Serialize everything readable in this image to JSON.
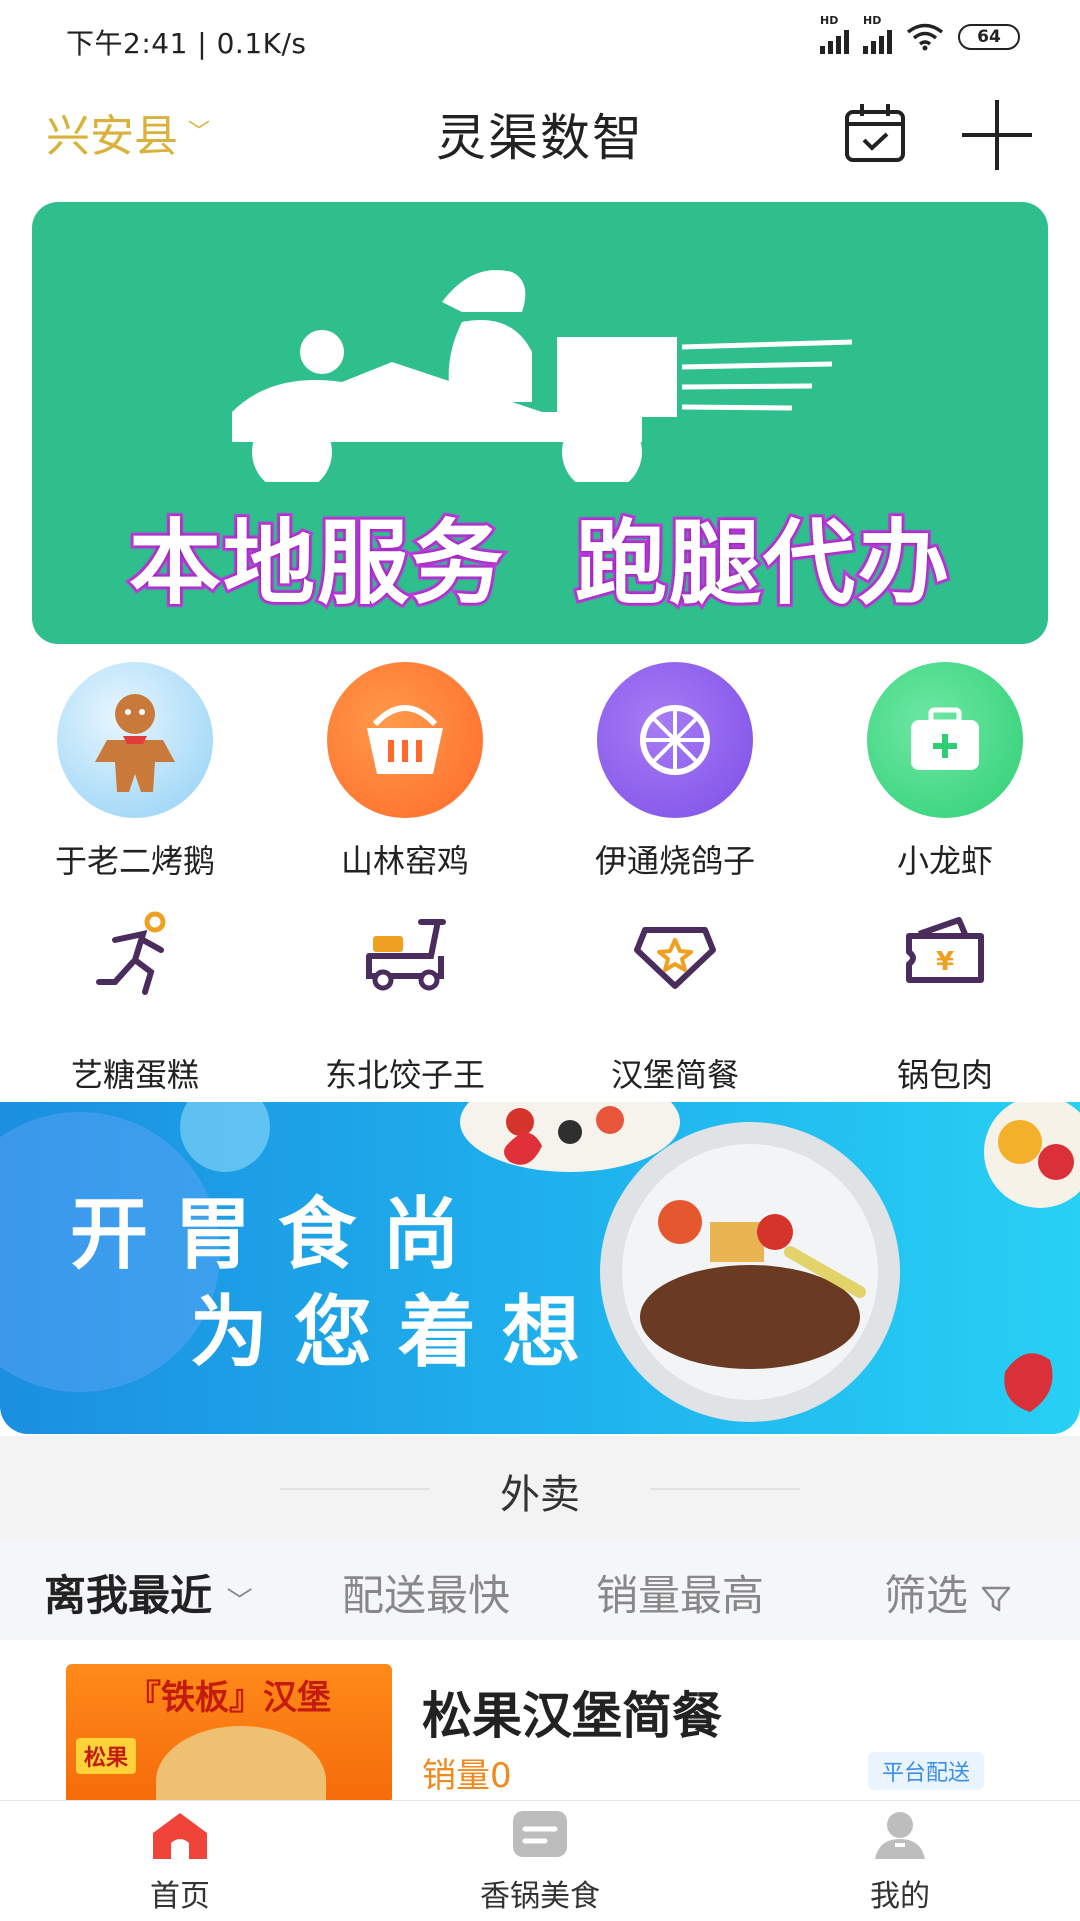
{
  "status": {
    "time": "下午2:41 | 0.1K/s",
    "sig_label": "HD",
    "battery": "64"
  },
  "header": {
    "location": "兴安县",
    "title": "灵渠数智"
  },
  "banner1": {
    "slogan_left": "本地服务",
    "slogan_right": "跑腿代办",
    "color": "#2fbf8c"
  },
  "categories": [
    {
      "label": "于老二烤鹅",
      "icon": "gingerbread-icon"
    },
    {
      "label": "山林窑鸡",
      "icon": "basket-icon"
    },
    {
      "label": "伊通烧鸽子",
      "icon": "lemon-icon"
    },
    {
      "label": "小龙虾",
      "icon": "medical-kit-icon"
    },
    {
      "label": "艺糖蛋糕",
      "icon": "running-icon"
    },
    {
      "label": "东北饺子王",
      "icon": "scooter-icon"
    },
    {
      "label": "汉堡简餐",
      "icon": "star-badge-icon"
    },
    {
      "label": "锅包肉",
      "icon": "wallet-yen-icon"
    }
  ],
  "banner2": {
    "line1": "开胃食尚",
    "line2": "为您着想"
  },
  "section": {
    "title": "外卖"
  },
  "sort": {
    "nearest": "离我最近",
    "fastest": "配送最快",
    "top_sales": "销量最高",
    "filter": "筛选"
  },
  "shop": {
    "thumb_title": "『铁板』汉堡",
    "thumb_tag": "松果",
    "name": "松果汉堡简餐",
    "sales": "销量0",
    "badge": "平台配送"
  },
  "tabs": [
    {
      "label": "首页",
      "icon": "home-icon",
      "active": true
    },
    {
      "label": "香锅美食",
      "icon": "message-icon",
      "active": false
    },
    {
      "label": "我的",
      "icon": "user-icon",
      "active": false
    }
  ],
  "colors": {
    "accent_gold": "#d9b23b",
    "active_tab": "#f0433a",
    "sales_orange": "#f08a1e"
  }
}
